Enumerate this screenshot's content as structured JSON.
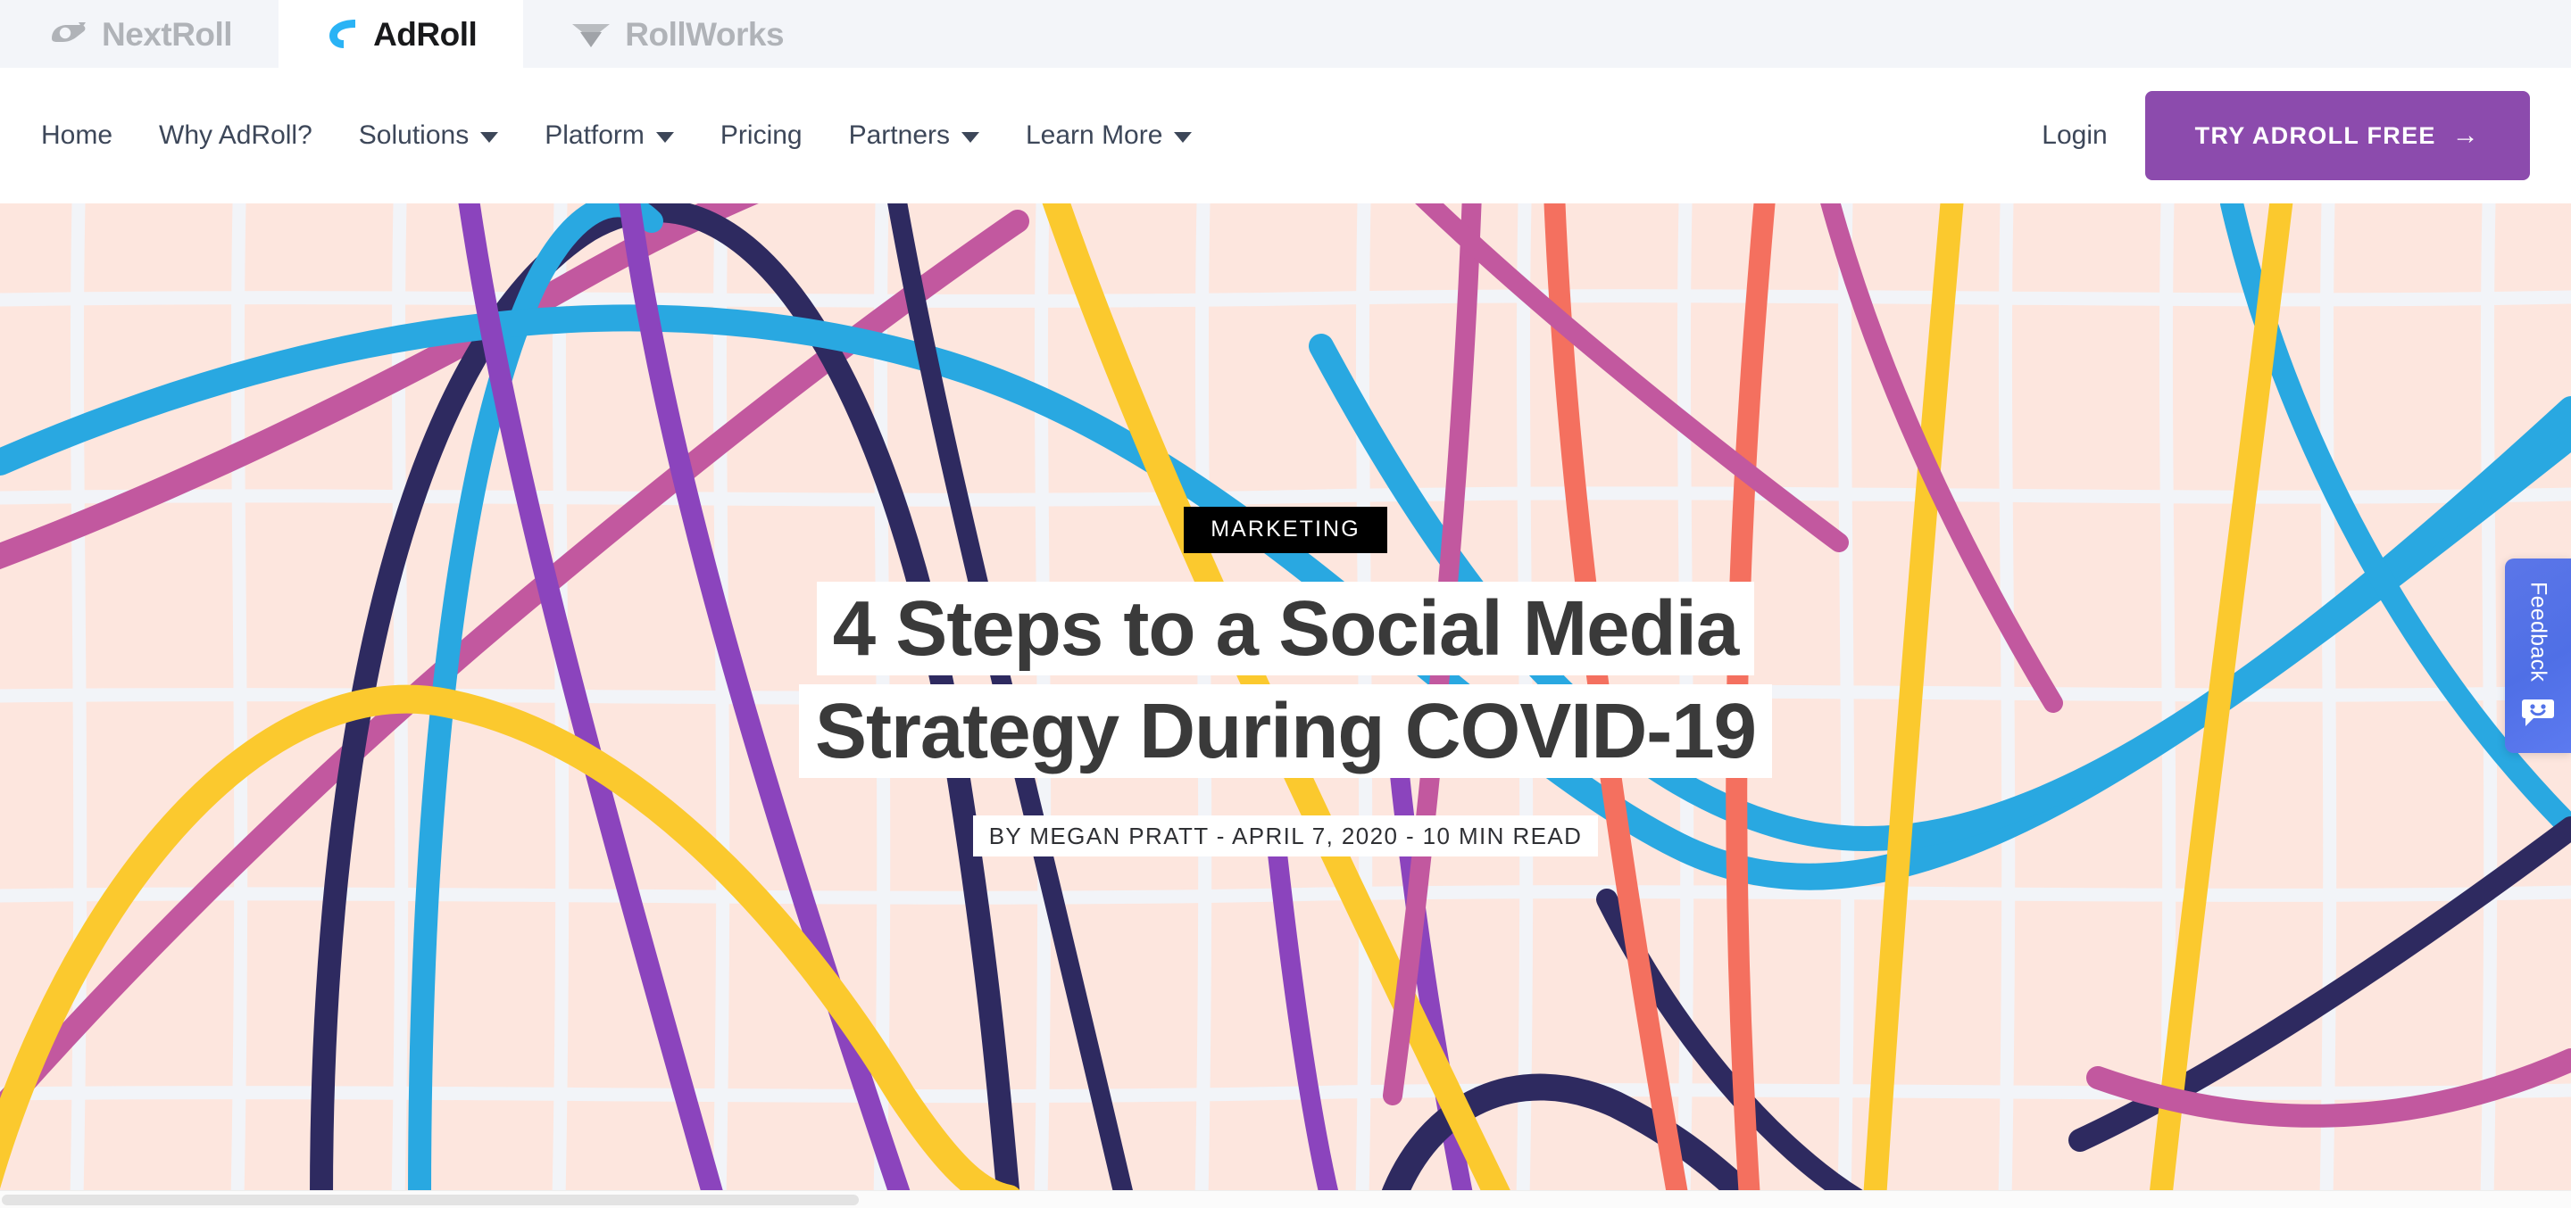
{
  "brand_bar": {
    "tabs": [
      {
        "name": "NextRoll",
        "icon": "nextroll-logo-icon",
        "active": false
      },
      {
        "name": "AdRoll",
        "icon": "adroll-logo-icon",
        "active": true
      },
      {
        "name": "RollWorks",
        "icon": "rollworks-logo-icon",
        "active": false
      }
    ]
  },
  "nav": {
    "items": [
      {
        "label": "Home",
        "has_dropdown": false
      },
      {
        "label": "Why AdRoll?",
        "has_dropdown": false
      },
      {
        "label": "Solutions",
        "has_dropdown": true
      },
      {
        "label": "Platform",
        "has_dropdown": true
      },
      {
        "label": "Pricing",
        "has_dropdown": false
      },
      {
        "label": "Partners",
        "has_dropdown": true
      },
      {
        "label": "Learn More",
        "has_dropdown": true
      }
    ],
    "login_label": "Login",
    "cta_label": "TRY ADROLL FREE",
    "cta_arrow": "→",
    "cta_color": "#8c4bad"
  },
  "hero": {
    "category": "MARKETING",
    "title_line_1": "4 Steps to a Social Media",
    "title_line_2": "Strategy During COVID-19",
    "byline": "BY MEGAN PRATT  -  APRIL 7, 2020  -  10 MIN READ",
    "author": "MEGAN PRATT",
    "date": "APRIL 7, 2020",
    "read_time": "10 MIN READ",
    "background_color": "#fde6de",
    "grid_color": "#f2f4f8",
    "title_color": "#3a3a3a",
    "badge_background": "#000000",
    "curve_colors": {
      "blue": "#29a8e1",
      "navy": "#2e2a60",
      "purple": "#8b44bd",
      "magenta": "#c2589f",
      "coral": "#f4705f",
      "yellow": "#fbc92e"
    }
  },
  "feedback_widget": {
    "label": "Feedback",
    "icon": "smiley-chat-icon",
    "color": "#5272e8"
  },
  "scrollbar": {
    "orientation": "horizontal",
    "position": "bottom"
  }
}
